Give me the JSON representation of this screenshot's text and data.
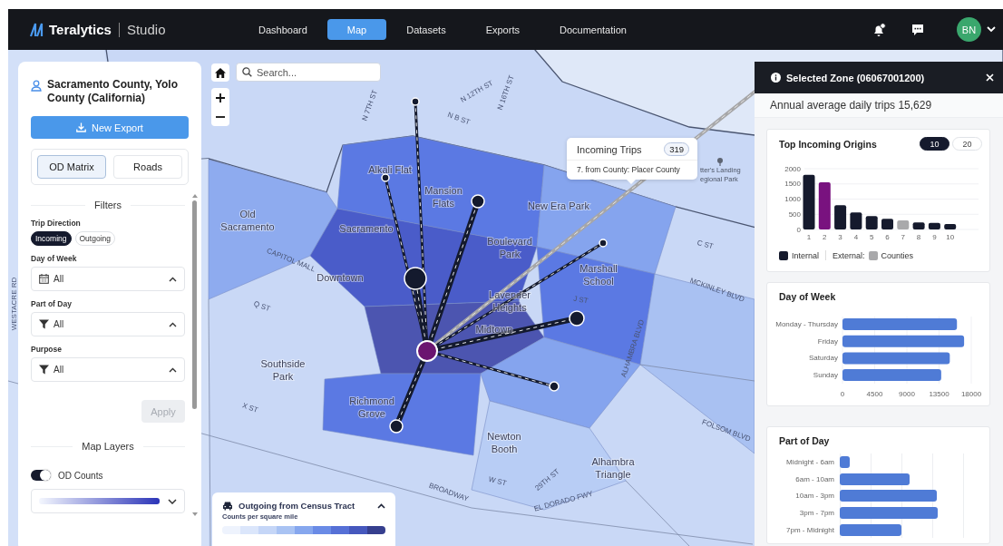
{
  "nav": {
    "brand": "Teralytics",
    "product": "Studio",
    "notifications": true,
    "avatar": "BN",
    "tabs": [
      {
        "label": "Dashboard",
        "selected": false
      },
      {
        "label": "Map",
        "selected": true
      },
      {
        "label": "Datasets",
        "selected": false
      },
      {
        "label": "Exports",
        "selected": false
      },
      {
        "label": "Documentation",
        "selected": false
      }
    ]
  },
  "sidebar": {
    "title": "Sacramento County, Yolo County (California)",
    "export_button": "New Export",
    "views": [
      {
        "label": "OD Matrix",
        "selected": true
      },
      {
        "label": "Roads",
        "selected": false
      }
    ],
    "filters_heading": "Filters",
    "trip_direction": {
      "label": "Trip Direction",
      "options": [
        {
          "label": "Incoming",
          "selected": true
        },
        {
          "label": "Outgoing",
          "selected": false
        }
      ]
    },
    "selects": [
      {
        "label": "Day of Week",
        "kind": "calendar",
        "value": "All",
        "expanded": true
      },
      {
        "label": "Part of Day",
        "kind": "filter",
        "value": "All",
        "expanded": true
      },
      {
        "label": "Purpose",
        "kind": "filter",
        "value": "All",
        "expanded": true
      }
    ],
    "apply_button": {
      "label": "Apply",
      "disabled": true
    },
    "layers_heading": "Map Layers",
    "layers": [
      {
        "label": "OD Counts",
        "on": true
      }
    ],
    "color_scale": {
      "expanded": false
    }
  },
  "map": {
    "search": {
      "placeholder": "Search..."
    },
    "labels": [
      {
        "kind": "place",
        "text": "Alkali Flat"
      },
      {
        "kind": "place",
        "text": "Mansion Flats"
      },
      {
        "kind": "place",
        "text": "New Era Park"
      },
      {
        "kind": "place",
        "text": "Old Sacramento"
      },
      {
        "kind": "place",
        "text": "Sacramento"
      },
      {
        "kind": "place",
        "text": "Boulevard Park"
      },
      {
        "kind": "place",
        "text": "Downtown"
      },
      {
        "kind": "place",
        "text": "Marshall School"
      },
      {
        "kind": "place",
        "text": "Lavender Heights"
      },
      {
        "kind": "place",
        "text": "Midtown"
      },
      {
        "kind": "place",
        "text": "Southside Park"
      },
      {
        "kind": "place",
        "text": "Richmond Grove"
      },
      {
        "kind": "place",
        "text": "Newton Booth"
      },
      {
        "kind": "place",
        "text": "Alhambra Triangle"
      },
      {
        "kind": "park",
        "text": "tter's Landing egional Park"
      },
      {
        "kind": "street",
        "text": "N 12TH ST"
      },
      {
        "kind": "street",
        "text": "N 16TH ST"
      },
      {
        "kind": "street",
        "text": "N 7TH ST"
      },
      {
        "kind": "street",
        "text": "N B ST"
      },
      {
        "kind": "street",
        "text": "CAPITOL MALL"
      },
      {
        "kind": "street",
        "text": "C ST"
      },
      {
        "kind": "street",
        "text": "MCKINLEY BLVD"
      },
      {
        "kind": "street",
        "text": "ALHAMBRA BLVD"
      },
      {
        "kind": "street",
        "text": "J ST"
      },
      {
        "kind": "street",
        "text": "Q ST"
      },
      {
        "kind": "street",
        "text": "X ST"
      },
      {
        "kind": "street",
        "text": "BROADWAY"
      },
      {
        "kind": "street",
        "text": "EL DORADO FWY"
      },
      {
        "kind": "street",
        "text": "FOLSOM BLVD"
      },
      {
        "kind": "street",
        "text": "WESTACRE RD"
      },
      {
        "kind": "street",
        "text": "W ST"
      },
      {
        "kind": "street",
        "text": "29TH ST"
      }
    ],
    "tooltip": {
      "title": "Incoming Trips",
      "count": "319",
      "detail": "7. from County: Placer County"
    },
    "legend": {
      "title": "Outgoing from Census Tract",
      "subtitle": "Counts per square mile",
      "expanded": true
    }
  },
  "zone_panel": {
    "title": "Selected Zone (06067001200)",
    "summary": "Annual average daily trips 15,629",
    "origins": {
      "title": "Top Incoming Origins",
      "counts": [
        {
          "label": "10",
          "selected": true
        },
        {
          "label": "20",
          "selected": false
        }
      ],
      "chart_data": {
        "type": "bar",
        "categories": [
          "1",
          "2",
          "3",
          "4",
          "5",
          "6",
          "7",
          "8",
          "9",
          "10"
        ],
        "stacked": true,
        "grid": true,
        "ylim": [
          0,
          2000
        ],
        "yticks": [
          0,
          500,
          1000,
          1500,
          2000
        ],
        "series": [
          {
            "name": "Internal",
            "color": "#151a2d",
            "values": [
              1800,
              null,
              800,
              560,
              440,
              350,
              null,
              230,
              220,
              180
            ]
          },
          {
            "name": "Counties",
            "color": "#a9a9ab",
            "values": [
              null,
              null,
              null,
              null,
              null,
              null,
              300,
              null,
              null,
              null
            ]
          },
          {
            "color": "#79127f",
            "values": [
              null,
              1550,
              null,
              null,
              null,
              null,
              null,
              null,
              null,
              null
            ]
          }
        ]
      },
      "legend_external_label": "External:"
    },
    "day_of_week": {
      "title": "Day of Week",
      "chart_data": {
        "type": "bar",
        "orientation": "horizontal",
        "categories": [
          "Monday - Thursday",
          "Friday",
          "Saturday",
          "Sunday"
        ],
        "values": [
          16000,
          17000,
          15000,
          13800
        ],
        "grid": true,
        "xlim": [
          0,
          18000
        ],
        "xticks": [
          0,
          4500,
          9000,
          13500,
          18000
        ]
      }
    },
    "part_of_day": {
      "title": "Part of Day",
      "bars": [
        {
          "label": "Midnight - 6am",
          "level": 0.07
        },
        {
          "label": "6am - 10am",
          "level": 0.49
        },
        {
          "label": "10am - 3pm",
          "level": 0.68
        },
        {
          "label": "3pm - 7pm",
          "level": 0.69
        },
        {
          "label": "7pm - Midnight",
          "level": 0.43
        }
      ]
    }
  }
}
